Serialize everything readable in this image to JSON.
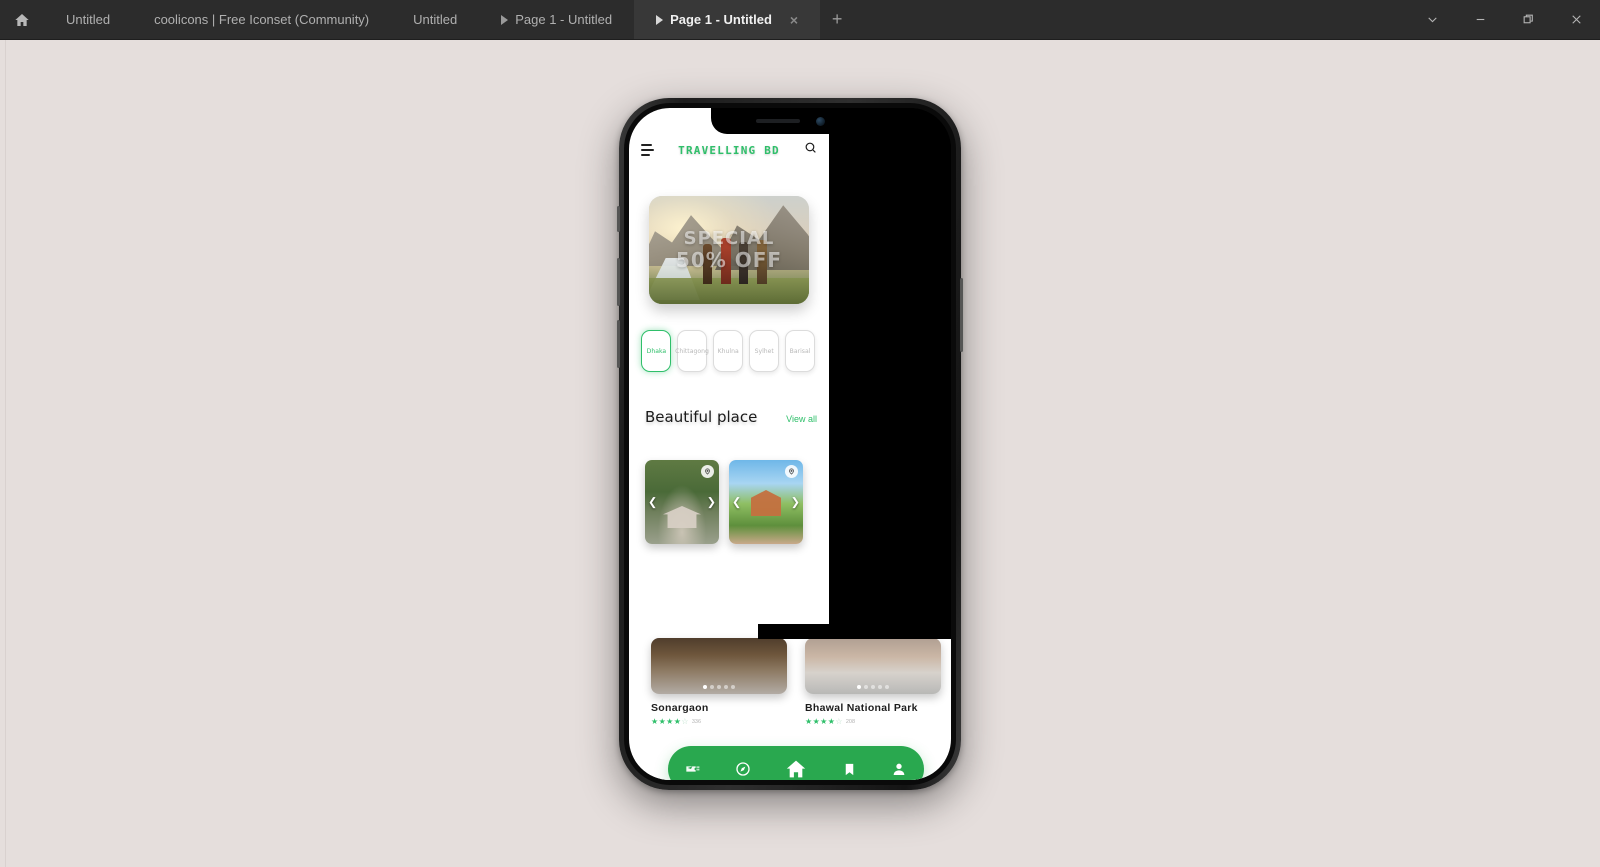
{
  "window": {
    "home_icon": "home-icon",
    "controls": {
      "chevron": "chevron-down-icon",
      "minimize": "minimize-icon",
      "maximize": "restore-icon",
      "close": "close-icon"
    }
  },
  "tabs": [
    {
      "label": "Untitled",
      "active": false,
      "has_play": false
    },
    {
      "label": "coolicons | Free Iconset (Community)",
      "active": false,
      "has_play": false
    },
    {
      "label": "Untitled",
      "active": false,
      "has_play": false
    },
    {
      "label": "Page 1 - Untitled",
      "active": false,
      "has_play": true
    },
    {
      "label": "Page 1 - Untitled",
      "active": true,
      "has_play": true
    }
  ],
  "new_tab_label": "+",
  "close_tab_label": "×",
  "colors": {
    "canvas_bg": "#e5dedc",
    "tabbar_bg": "#2c2c2c",
    "brand_green": "#2fbf6a",
    "nav_green": "#29a84f",
    "star_green": "#2fbf6a"
  },
  "app": {
    "header": {
      "menu_icon": "hamburger-menu-icon",
      "title": "TRAVELLING BD",
      "search_icon": "search-icon"
    },
    "banner": {
      "line1": "SPECIAL",
      "line2": "50% OFF",
      "alt": "hikers-on-mountain-trail"
    },
    "cities": [
      {
        "label": "Dhaka",
        "selected": true
      },
      {
        "label": "Chittagong",
        "selected": false
      },
      {
        "label": "Khulna",
        "selected": false
      },
      {
        "label": "Sylhet",
        "selected": false
      },
      {
        "label": "Barisal",
        "selected": false
      }
    ],
    "section": {
      "title": "Beautiful place",
      "view_all": "View all"
    },
    "place_cards": [
      {
        "name": "Sonargaon",
        "stars_filled": 4,
        "stars_total": 5,
        "rating_count": "336",
        "pin_icon": "location-pin-icon",
        "prev_icon": "chevron-left-icon",
        "next_icon": "chevron-right-icon",
        "dots_total": 5,
        "dot_active": 1
      },
      {
        "name": "Bhawal National Park",
        "stars_filled": 4,
        "stars_total": 5,
        "rating_count": "208",
        "pin_icon": "location-pin-icon",
        "prev_icon": "chevron-left-icon",
        "next_icon": "chevron-right-icon",
        "dots_total": 5,
        "dot_active": 1
      }
    ],
    "bottom_nav": [
      {
        "icon": "ticket-icon",
        "active": false
      },
      {
        "icon": "compass-icon",
        "active": false
      },
      {
        "icon": "home-icon",
        "active": true
      },
      {
        "icon": "bookmark-icon",
        "active": false
      },
      {
        "icon": "person-icon",
        "active": false
      }
    ]
  }
}
